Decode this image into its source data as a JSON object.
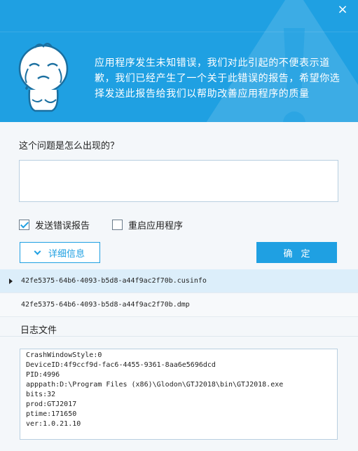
{
  "header": {
    "close_glyph": "×",
    "message": "应用程序发生未知错误，我们对此引起的不便表示道歉，我们已经产生了一个关于此错误的报告，希望你选择发送此报告给我们以帮助改善应用程序的质量",
    "accent_color": "#1fa0e2"
  },
  "form": {
    "question": "这个问题是怎么出现的？",
    "description_value": "",
    "send_report_label": "发送错误报告",
    "send_report_checked": true,
    "restart_label": "重启应用程序",
    "restart_checked": false,
    "details_label": "详细信息",
    "ok_label": "确定"
  },
  "files": [
    {
      "name": "42fe5375-64b6-4093-b5d8-a44f9ac2f70b.cusinfo",
      "selected": true
    },
    {
      "name": "42fe5375-64b6-4093-b5d8-a44f9ac2f70b.dmp",
      "selected": false
    }
  ],
  "log": {
    "label": "日志文件",
    "lines": [
      "CrashWindowStyle:0",
      "DeviceID:4f9ccf9d-fac6-4455-9361-8aa6e5696dcd",
      "PID:4996",
      "apppath:D:\\Program Files (x86)\\Glodon\\GTJ2018\\bin\\GTJ2018.exe",
      "bits:32",
      "prod:GTJ2017",
      "ptime:171650",
      "ver:1.0.21.10"
    ]
  }
}
